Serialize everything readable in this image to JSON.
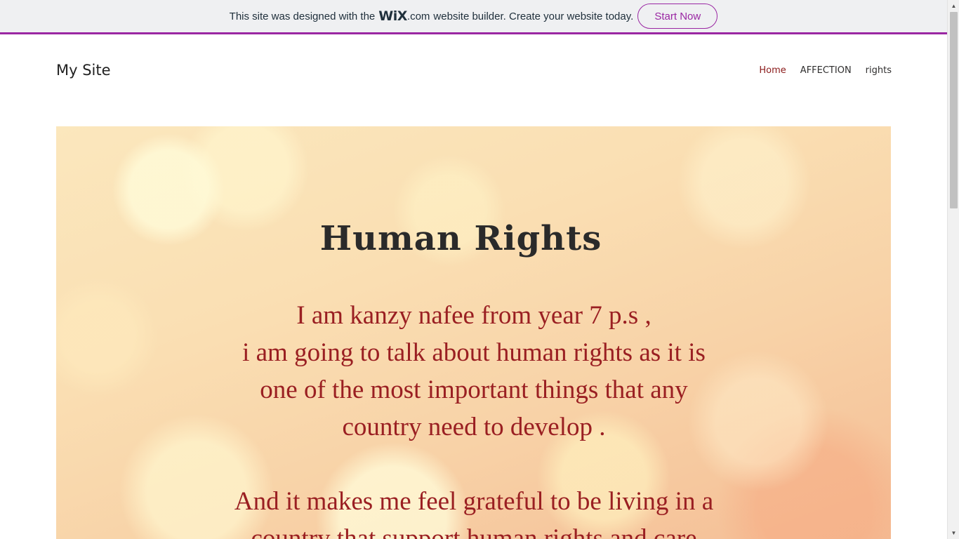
{
  "banner": {
    "prefix": "This site was designed with the",
    "logo": "WiX",
    "domain": ".com",
    "suffix": "website builder. Create your website today.",
    "cta": "Start Now",
    "accent_color": "#9a27a3"
  },
  "header": {
    "site_title": "My Site",
    "nav": [
      {
        "label": "Home",
        "active": true
      },
      {
        "label": "AFFECTION",
        "active": false
      },
      {
        "label": "rights",
        "active": false
      }
    ]
  },
  "hero": {
    "title": "Human Rights",
    "paragraph1": [
      "I am kanzy nafee from year 7 p.s ,",
      "i am going to talk about human rights as it is",
      "one of the most important things that any",
      "country need to develop ."
    ],
    "paragraph2": [
      "And it makes me feel grateful to be living in a",
      "country that support human rights and care"
    ],
    "text_color": "#9a1f22"
  },
  "icons": {
    "scroll_up": "scroll-up-arrow-icon",
    "scroll_down": "scroll-down-arrow-icon"
  }
}
